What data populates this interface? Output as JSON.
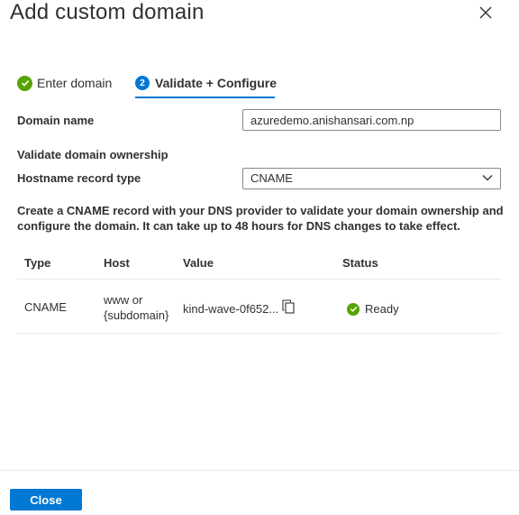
{
  "dialog": {
    "title": "Add custom domain"
  },
  "steps": [
    {
      "label": "Enter domain",
      "status": "complete"
    },
    {
      "number": "2",
      "label": "Validate + Configure",
      "status": "active"
    }
  ],
  "form": {
    "domain_name_label": "Domain name",
    "domain_name_value": "azuredemo.anishansari.com.np",
    "section_heading": "Validate domain ownership",
    "record_type_label": "Hostname record type",
    "record_type_value": "CNAME"
  },
  "description": "Create a CNAME record with your DNS provider to validate your domain ownership and configure the domain. It can take up to 48 hours for DNS changes to take effect.",
  "table": {
    "headers": [
      "Type",
      "Host",
      "Value",
      "Status"
    ],
    "rows": [
      {
        "type": "CNAME",
        "host_line1": "www or",
        "host_line2": "{subdomain}",
        "value": "kind-wave-0f652...",
        "status": "Ready"
      }
    ]
  },
  "footer": {
    "close_label": "Close"
  },
  "colors": {
    "accent": "#0078d4",
    "success": "#57a300"
  },
  "icons": [
    "close-icon",
    "checkmark-icon",
    "copy-icon",
    "chevron-down-icon"
  ]
}
